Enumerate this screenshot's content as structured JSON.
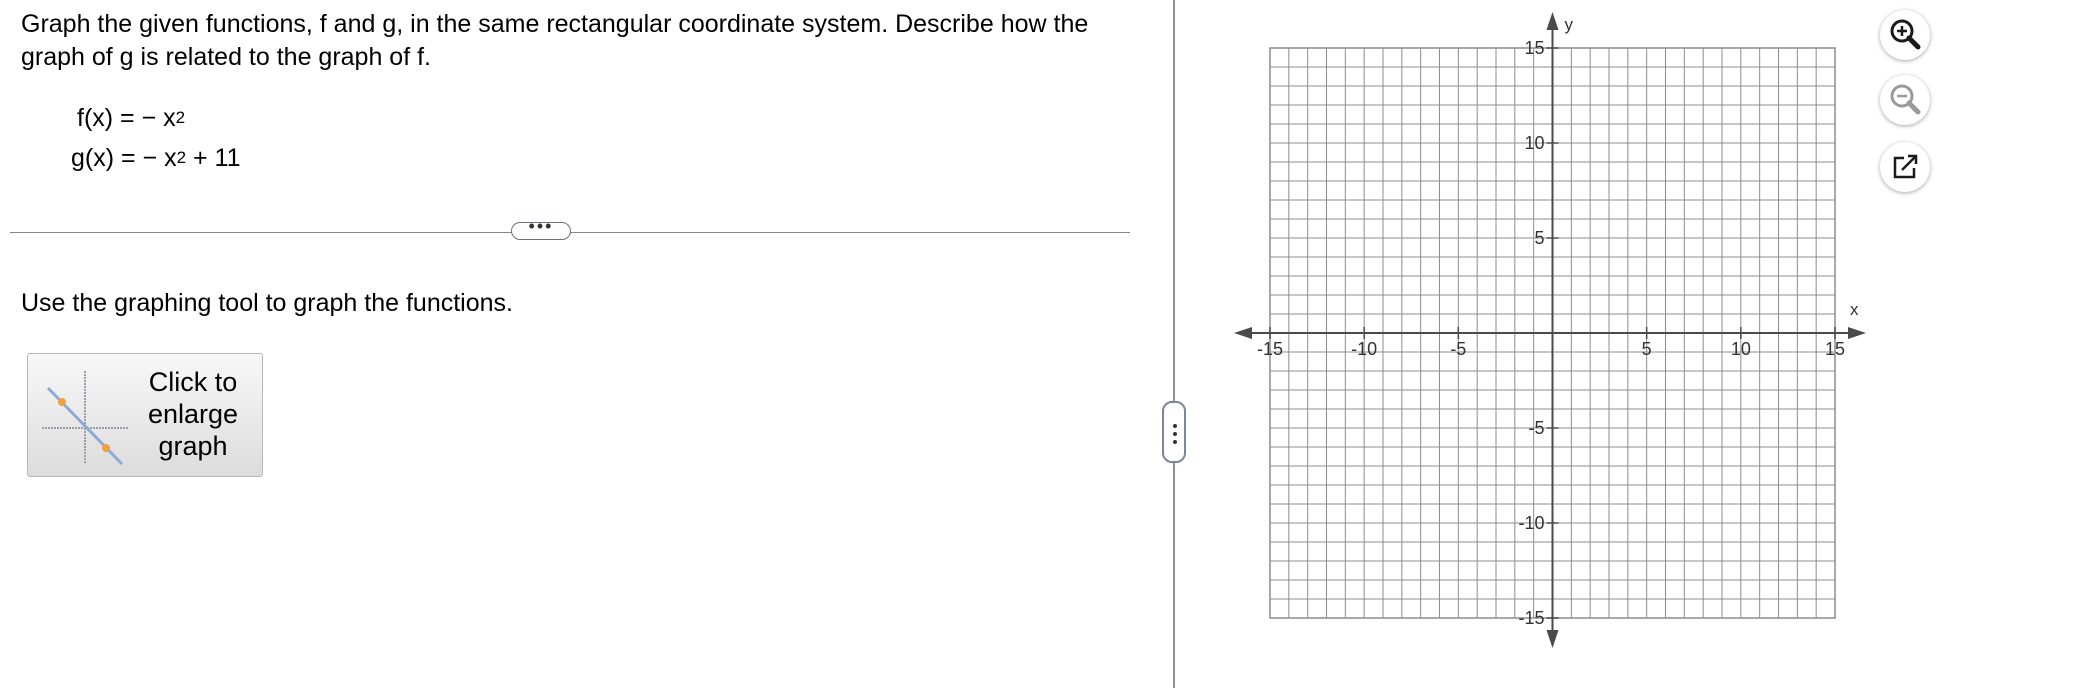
{
  "question": {
    "text": "Graph the given functions, f and g, in the same rectangular coordinate system. Describe how the graph of g is related to the graph of f.",
    "f_label": "f(x) = − x",
    "f_exp": "2",
    "g_label": "g(x) = − x",
    "g_exp": "2",
    "g_tail": " + 11"
  },
  "divider_handle": "•••",
  "instruction": "Use the graphing tool to graph the functions.",
  "enlarge_button": {
    "label": "Click to enlarge graph"
  },
  "graph": {
    "x_label": "x",
    "y_label": "y",
    "xlim": [
      -15,
      15
    ],
    "ylim": [
      -15,
      15
    ],
    "minor_step": 1,
    "x_tick_labels": [
      {
        "value": -15,
        "text": "-15"
      },
      {
        "value": -10,
        "text": "-10"
      },
      {
        "value": -5,
        "text": "-5"
      },
      {
        "value": 5,
        "text": "5"
      },
      {
        "value": 10,
        "text": "10"
      },
      {
        "value": 15,
        "text": "15"
      }
    ],
    "y_tick_labels": [
      {
        "value": 15,
        "text": "15"
      },
      {
        "value": 10,
        "text": "10"
      },
      {
        "value": 5,
        "text": "5"
      },
      {
        "value": -5,
        "text": "-5"
      },
      {
        "value": -10,
        "text": "-10"
      },
      {
        "value": -15,
        "text": "-15"
      }
    ],
    "grid_color": "#8c8c8c",
    "axis_color": "#4a4a4a"
  },
  "tools": {
    "zoom_in": "zoom-in-icon",
    "zoom_out": "zoom-out-icon",
    "popout": "popout-icon"
  },
  "colors": {
    "icon_active": "#1a1a1a",
    "icon_inactive": "#9a9a9a",
    "point_orange": "#f0a040",
    "line_blue": "#8fa8d8"
  }
}
